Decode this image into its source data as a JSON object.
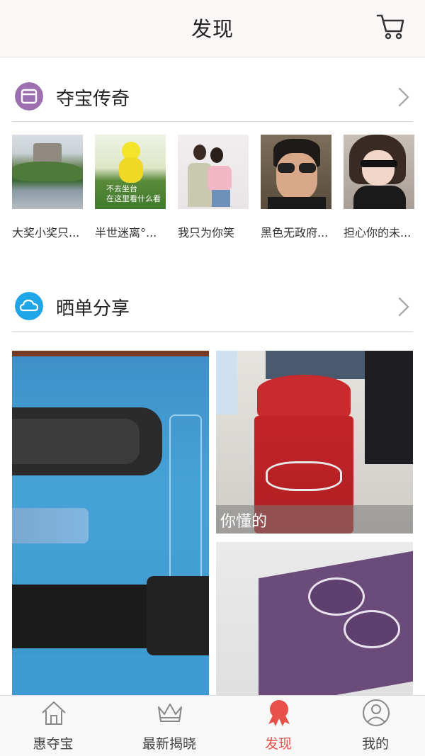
{
  "header": {
    "title": "发现",
    "cart_icon": "cart-icon"
  },
  "sections": {
    "treasure": {
      "title": "夺宝传奇",
      "icon": "archive-box-icon",
      "icon_color": "#9b6fb0"
    },
    "share": {
      "title": "晒单分享",
      "icon": "cloud-icon",
      "icon_color": "#1fa6e8"
    }
  },
  "winners": [
    {
      "caption": "大奖小奖只...",
      "image_text": ""
    },
    {
      "caption": "半世迷离°...",
      "image_text": "不去坐台\n在这里看什么看"
    },
    {
      "caption": "我只为你笑",
      "image_text": ""
    },
    {
      "caption": "黑色无政府...",
      "image_text": ""
    },
    {
      "caption": "担心你的未...",
      "image_text": ""
    }
  ],
  "posts": [
    {
      "caption": ""
    },
    {
      "caption": "你懂的"
    },
    {
      "caption": ""
    }
  ],
  "tabs": [
    {
      "label": "惠夺宝",
      "icon": "home-icon",
      "active": false
    },
    {
      "label": "最新揭晓",
      "icon": "crown-icon",
      "active": false
    },
    {
      "label": "发现",
      "icon": "award-ribbon-icon",
      "active": true
    },
    {
      "label": "我的",
      "icon": "user-icon",
      "active": false
    }
  ],
  "colors": {
    "accent": "#e8504a",
    "header_bg": "#fbf7f7"
  }
}
